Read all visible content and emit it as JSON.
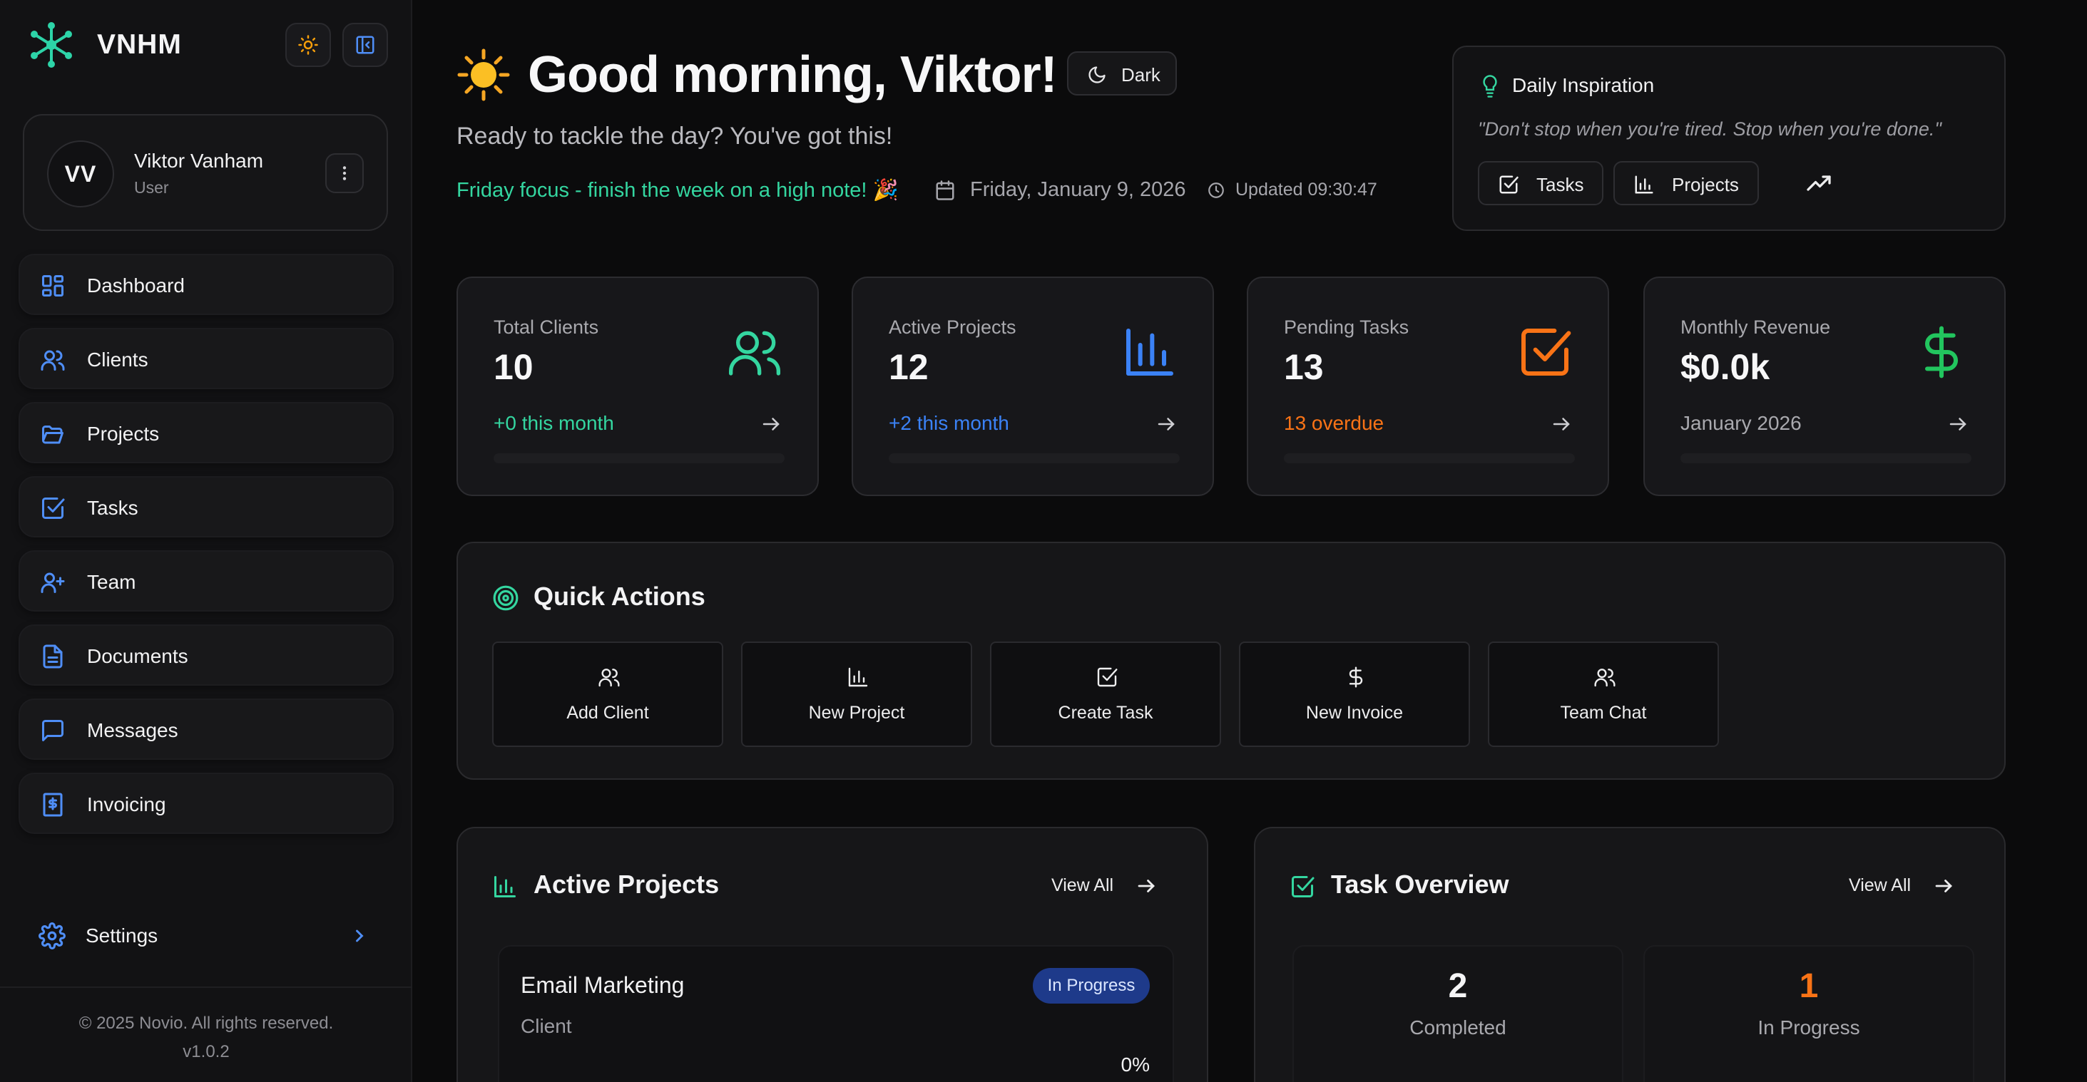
{
  "brand": {
    "name": "VNHM"
  },
  "user": {
    "initials": "VV",
    "name": "Viktor Vanham",
    "role": "User"
  },
  "nav": {
    "items": [
      {
        "label": "Dashboard"
      },
      {
        "label": "Clients"
      },
      {
        "label": "Projects"
      },
      {
        "label": "Tasks"
      },
      {
        "label": "Team"
      },
      {
        "label": "Documents"
      },
      {
        "label": "Messages"
      },
      {
        "label": "Invoicing"
      }
    ],
    "settings": "Settings"
  },
  "footer": {
    "copyright": "© 2025 Novio. All rights reserved.",
    "version": "v1.0.2"
  },
  "header": {
    "greeting": "Good morning, Viktor!",
    "mode_label": "Dark",
    "subtitle": "Ready to tackle the day? You've got this!",
    "focus": "Friday focus - finish the week on a high note! 🎉",
    "date": "Friday, January 9, 2026",
    "updated": "Updated 09:30:47"
  },
  "inspiration": {
    "title": "Daily Inspiration",
    "quote": "\"Don't stop when you're tired. Stop when you're done.\"",
    "tasks_label": "Tasks",
    "projects_label": "Projects"
  },
  "stats": [
    {
      "label": "Total Clients",
      "value": "10",
      "sub": "+0 this month",
      "color": "#34d6a0"
    },
    {
      "label": "Active Projects",
      "value": "12",
      "sub": "+2 this month",
      "color": "#3b82f6"
    },
    {
      "label": "Pending Tasks",
      "value": "13",
      "sub": "13 overdue",
      "color": "#f97316"
    },
    {
      "label": "Monthly Revenue",
      "value": "$0.0k",
      "sub": "January 2026",
      "color": "#22c55e"
    }
  ],
  "quick_actions": {
    "title": "Quick Actions",
    "buttons": [
      {
        "label": "Add Client"
      },
      {
        "label": "New Project"
      },
      {
        "label": "Create Task"
      },
      {
        "label": "New Invoice"
      },
      {
        "label": "Team Chat"
      }
    ]
  },
  "active_projects": {
    "title": "Active Projects",
    "view_all": "View All",
    "project": {
      "name": "Email Marketing",
      "client": "Client",
      "status": "In Progress",
      "progress": "0%"
    }
  },
  "task_overview": {
    "title": "Task Overview",
    "view_all": "View All",
    "completed": {
      "count": "2",
      "label": "Completed"
    },
    "in_progress": {
      "count": "1",
      "label": "In Progress"
    }
  },
  "colors": {
    "accent": "#34d6a0",
    "blue": "#3b82f6",
    "orange": "#f97316",
    "green": "#22c55e"
  }
}
